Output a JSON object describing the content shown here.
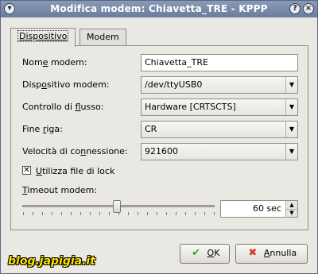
{
  "window": {
    "title": "Modifica modem: Chiavetta_TRE - KPPP",
    "help": "?",
    "close": "×"
  },
  "tabs": [
    {
      "label": "Dispositivo"
    },
    {
      "label": "Modem"
    }
  ],
  "form": {
    "name": {
      "label_a": "Nom",
      "label_u": "e",
      "label_b": " modem:",
      "value": "Chiavetta_TRE"
    },
    "device": {
      "label_a": "Disp",
      "label_u": "o",
      "label_b": "sitivo modem:",
      "value": "/dev/ttyUSB0"
    },
    "flow": {
      "label_a": "Controllo di ",
      "label_u": "f",
      "label_b": "lusso:",
      "value": "Hardware [CRTSCTS]"
    },
    "line_end": {
      "label_a": "Fine ",
      "label_u": "r",
      "label_b": "iga:",
      "value": "CR"
    },
    "speed": {
      "label_a": "Velocità di co",
      "label_u": "n",
      "label_b": "nessione:",
      "value": "921600"
    },
    "lock": {
      "label_u": "U",
      "label_b": "tilizza file di lock",
      "checked": true,
      "mark": "✕"
    },
    "timeout": {
      "label_u": "T",
      "label_b": "imeout modem:",
      "value": "60 sec",
      "level": 60
    }
  },
  "buttons": {
    "ok": {
      "label_u": "O",
      "label_b": "K",
      "icon": "✔",
      "color": "#2fa82f"
    },
    "cancel": {
      "label_u": "A",
      "label_b": "nnulla",
      "icon": "✖",
      "color": "#d23c2a"
    }
  },
  "watermark": "blog.japigia.it"
}
